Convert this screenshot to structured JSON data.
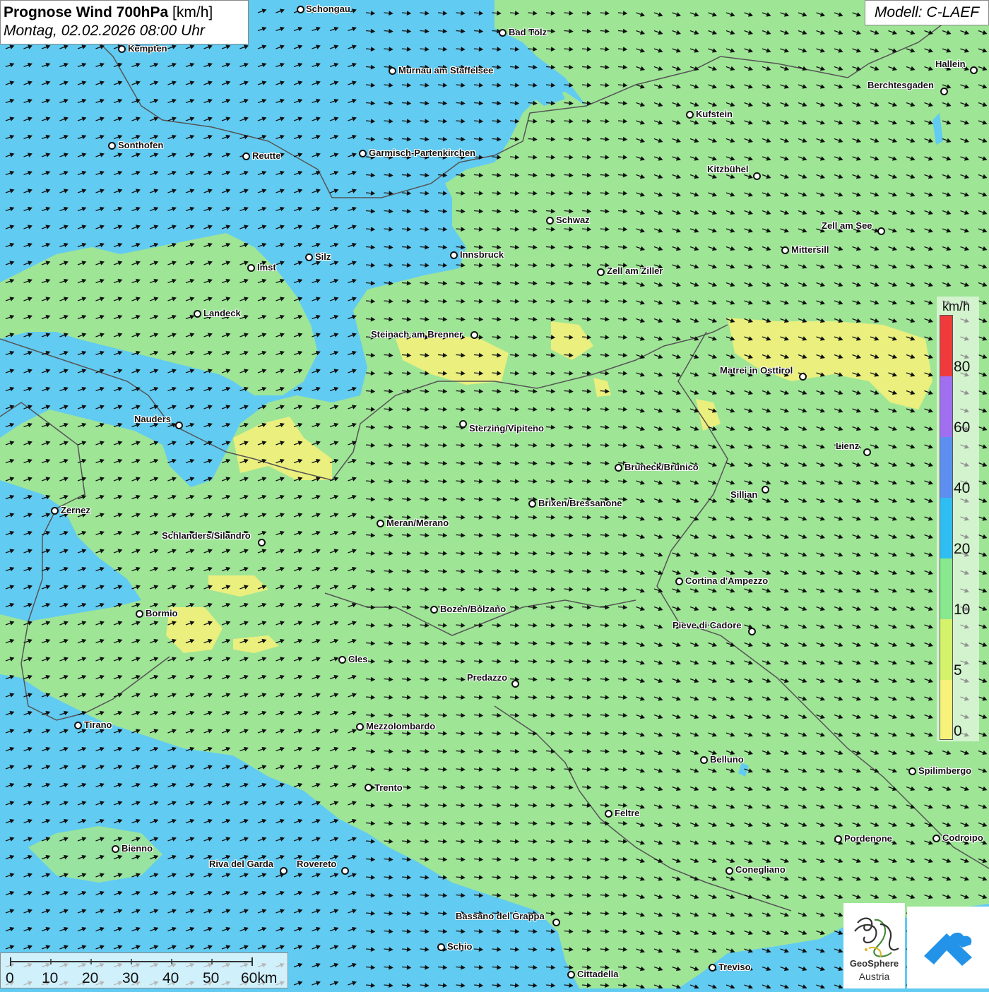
{
  "title": {
    "main": "Prognose Wind 700hPa",
    "unit": "[km/h]",
    "date": "Montag, 02.02.2026 08:00 Uhr"
  },
  "model": "Modell: C-LAEF",
  "legend": {
    "unit": "km/h",
    "ticks": [
      "80",
      "60",
      "40",
      "20",
      "10",
      "5",
      "0"
    ],
    "colors": [
      "#ef3b3b",
      "#a06ff0",
      "#5d8ff0",
      "#2fbdf2",
      "#88e88d",
      "#d4f26a",
      "#f7f27a"
    ]
  },
  "scalebar": {
    "labels": [
      "0",
      "10",
      "20",
      "30",
      "40",
      "50",
      "60km"
    ]
  },
  "logos": {
    "geosphere_line1": "GeoSphere",
    "geosphere_line2": "Austria",
    "icons": [
      "geosphere-logo-icon",
      "app-cloud-arrow-icon"
    ]
  },
  "colors": {
    "strong_wind_blue": "#62cbf2",
    "moderate_wind_green": "#9ee596",
    "light_wind_yellow": "#eaef7e",
    "border_line": "#555555"
  },
  "cities": [
    {
      "name": "Schongau"
    },
    {
      "name": "Bad Tölz"
    },
    {
      "name": "Kempten"
    },
    {
      "name": "Murnau am Staffelsee"
    },
    {
      "name": "Hallein"
    },
    {
      "name": "Berchtesgaden"
    },
    {
      "name": "Kufstein"
    },
    {
      "name": "Sonthofen"
    },
    {
      "name": "Reutte"
    },
    {
      "name": "Garmisch-Partenkirchen"
    },
    {
      "name": "Kitzbühel"
    },
    {
      "name": "Schwaz"
    },
    {
      "name": "Zell am See"
    },
    {
      "name": "Mittersill"
    },
    {
      "name": "Innsbruck"
    },
    {
      "name": "Imst"
    },
    {
      "name": "Silz"
    },
    {
      "name": "Zell am Ziller"
    },
    {
      "name": "Landeck"
    },
    {
      "name": "Steinach am Brenner"
    },
    {
      "name": "Matrei in Osttirol"
    },
    {
      "name": "Nauders"
    },
    {
      "name": "Sterzing/Vipiteno"
    },
    {
      "name": "Lienz"
    },
    {
      "name": "Bruneck/Brunico"
    },
    {
      "name": "Sillian"
    },
    {
      "name": "Zernez"
    },
    {
      "name": "Brixen/Bressanone"
    },
    {
      "name": "Meran/Merano"
    },
    {
      "name": "Schlanders/Silandro"
    },
    {
      "name": "Cortina d'Ampezzo"
    },
    {
      "name": "Bozen/Bolzano"
    },
    {
      "name": "Bormio"
    },
    {
      "name": "Pieve di Cadore"
    },
    {
      "name": "Cles"
    },
    {
      "name": "Predazzo"
    },
    {
      "name": "Tirano"
    },
    {
      "name": "Mezzolombardo"
    },
    {
      "name": "Belluno"
    },
    {
      "name": "Spilimbergo"
    },
    {
      "name": "Trento"
    },
    {
      "name": "Feltre"
    },
    {
      "name": "Bienno"
    },
    {
      "name": "Pordenone"
    },
    {
      "name": "Codroipo"
    },
    {
      "name": "Riva del Garda"
    },
    {
      "name": "Rovereto"
    },
    {
      "name": "Conegliano"
    },
    {
      "name": "Bassano del Grappa"
    },
    {
      "name": "Schio"
    },
    {
      "name": "Treviso"
    },
    {
      "name": "Cittadella"
    }
  ]
}
